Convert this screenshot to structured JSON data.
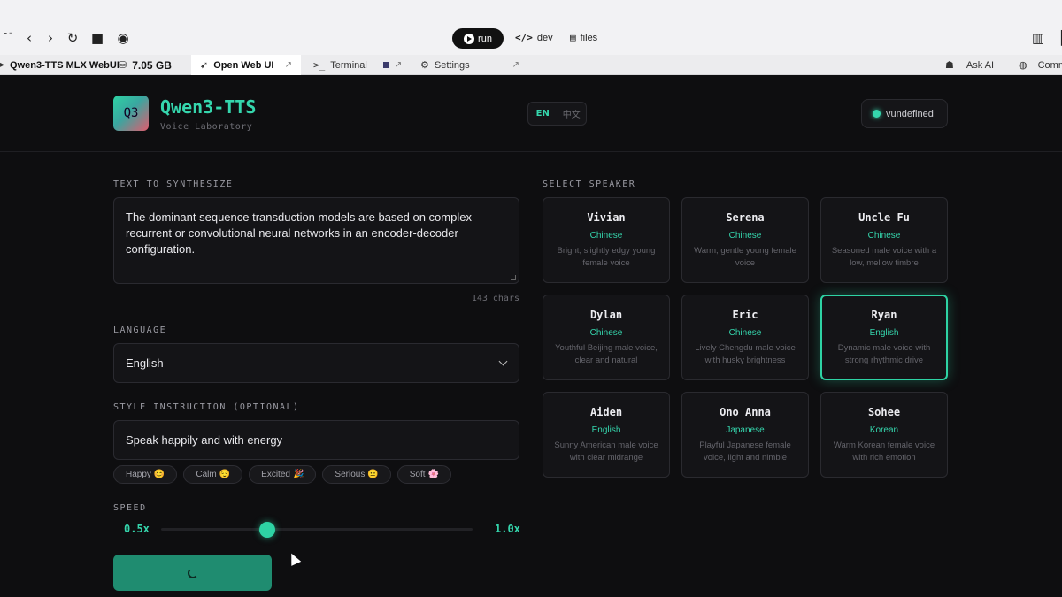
{
  "browser": {
    "run_label": "run",
    "dev_label": "dev",
    "files_label": "files",
    "tabs": {
      "app_name": "Qwen3-TTS MLX WebUI",
      "memory": "7.05 GB",
      "open_web_ui": "Open Web UI",
      "terminal": "Terminal",
      "settings": "Settings",
      "ask_ai": "Ask AI",
      "community": "Comm"
    }
  },
  "header": {
    "logo_text": "Q3",
    "title": "Qwen3-TTS",
    "subtitle": "Voice Laboratory",
    "lang_en": "EN",
    "lang_zh": "中文",
    "status": "vundefined"
  },
  "text_section": {
    "label": "TEXT TO SYNTHESIZE",
    "value": "The dominant sequence transduction models are based on complex recurrent or convolutional neural networks in an encoder-decoder configuration.",
    "char_count": "143 chars"
  },
  "language_section": {
    "label": "LANGUAGE",
    "selected": "English"
  },
  "style_section": {
    "label": "STYLE INSTRUCTION (OPTIONAL)",
    "value": "Speak happily and with energy",
    "presets": [
      {
        "label": "Happy",
        "emoji": "😊"
      },
      {
        "label": "Calm",
        "emoji": "😌"
      },
      {
        "label": "Excited",
        "emoji": "🎉"
      },
      {
        "label": "Serious",
        "emoji": "😐"
      },
      {
        "label": "Soft",
        "emoji": "🌸"
      }
    ]
  },
  "speed_section": {
    "label": "SPEED",
    "min_label": "0.5x",
    "value_label": "1.0x",
    "fraction": 0.34
  },
  "speaker_section": {
    "label": "SELECT SPEAKER",
    "speakers": [
      {
        "name": "Vivian",
        "language": "Chinese",
        "desc": "Bright, slightly edgy young female voice",
        "selected": false
      },
      {
        "name": "Serena",
        "language": "Chinese",
        "desc": "Warm, gentle young female voice",
        "selected": false
      },
      {
        "name": "Uncle Fu",
        "language": "Chinese",
        "desc": "Seasoned male voice with a low, mellow timbre",
        "selected": false
      },
      {
        "name": "Dylan",
        "language": "Chinese",
        "desc": "Youthful Beijing male voice, clear and natural",
        "selected": false
      },
      {
        "name": "Eric",
        "language": "Chinese",
        "desc": "Lively Chengdu male voice with husky brightness",
        "selected": false
      },
      {
        "name": "Ryan",
        "language": "English",
        "desc": "Dynamic male voice with strong rhythmic drive",
        "selected": true
      },
      {
        "name": "Aiden",
        "language": "English",
        "desc": "Sunny American male voice with clear midrange",
        "selected": false
      },
      {
        "name": "Ono Anna",
        "language": "Japanese",
        "desc": "Playful Japanese female voice, light and nimble",
        "selected": false
      },
      {
        "name": "Sohee",
        "language": "Korean",
        "desc": "Warm Korean female voice with rich emotion",
        "selected": false
      }
    ]
  },
  "colors": {
    "accent": "#35d6ad",
    "background": "#0e0e10",
    "button": "#1f8c70"
  }
}
